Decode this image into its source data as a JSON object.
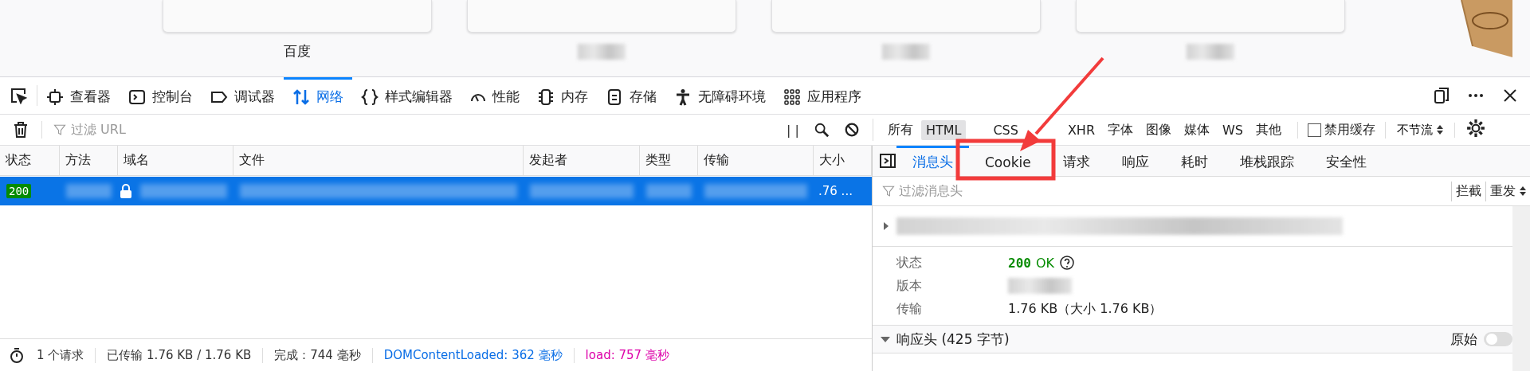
{
  "top_sites": [
    {
      "kind": "named",
      "label": "百度"
    },
    {
      "kind": "blurred"
    },
    {
      "kind": "blurred"
    },
    {
      "kind": "blurred"
    }
  ],
  "toolbar": {
    "tabs": [
      {
        "label": "查看器",
        "selected": false
      },
      {
        "label": "控制台",
        "selected": false
      },
      {
        "label": "调试器",
        "selected": false
      },
      {
        "label": "网络",
        "selected": true
      },
      {
        "label": "样式编辑器",
        "selected": false
      },
      {
        "label": "性能",
        "selected": false
      },
      {
        "label": "内存",
        "selected": false
      },
      {
        "label": "存储",
        "selected": false
      },
      {
        "label": "无障碍环境",
        "selected": false
      },
      {
        "label": "应用程序",
        "selected": false
      }
    ]
  },
  "filter_bar": {
    "placeholder": "过滤 URL",
    "pause": "| |",
    "types": [
      {
        "label": "所有",
        "selected": false
      },
      {
        "label": "HTML",
        "selected": true
      },
      {
        "label": "CSS",
        "selected": false
      },
      {
        "label": "XHR",
        "selected": false
      },
      {
        "label": "字体",
        "selected": false
      },
      {
        "label": "图像",
        "selected": false
      },
      {
        "label": "媒体",
        "selected": false
      },
      {
        "label": "WS",
        "selected": false
      },
      {
        "label": "其他",
        "selected": false
      }
    ],
    "disable_cache": {
      "label": "禁用缓存",
      "checked": false
    },
    "throttle": "不节流"
  },
  "table": {
    "columns": [
      "状态",
      "方法",
      "域名",
      "文件",
      "发起者",
      "类型",
      "传输",
      "大小"
    ],
    "rows": [
      {
        "status": "200",
        "size": ".76 ...",
        "selected": true
      }
    ]
  },
  "details": {
    "tabs": [
      {
        "label": "消息头",
        "selected": true
      },
      {
        "label": "Cookie",
        "selected": false
      },
      {
        "label": "请求",
        "selected": false
      },
      {
        "label": "响应",
        "selected": false
      },
      {
        "label": "耗时",
        "selected": false
      },
      {
        "label": "堆栈跟踪",
        "selected": false
      },
      {
        "label": "安全性",
        "selected": false
      }
    ],
    "filter_placeholder": "过滤消息头",
    "block": "拦截",
    "resend": "重发",
    "summary": [
      {
        "kind": "status",
        "label": "状态",
        "code": "200",
        "text": "OK"
      },
      {
        "kind": "blurred",
        "label": "版本"
      },
      {
        "kind": "text",
        "label": "传输",
        "value": "1.76 KB（大小 1.76 KB）"
      }
    ],
    "response_headers": {
      "title": "响应头 (425 字节)",
      "expanded": true,
      "raw_label": "原始",
      "raw_on": false
    }
  },
  "status_bar": [
    {
      "text": "1 个请求",
      "color": "#333333"
    },
    {
      "text": "已传输 1.76 KB / 1.76 KB",
      "color": "#333333"
    },
    {
      "text": "完成：744 毫秒",
      "color": "#333333"
    },
    {
      "text": "DOMContentLoaded: 362 毫秒",
      "color": "#0a6ee6"
    },
    {
      "text": "load: 757 毫秒",
      "color": "#dd00a9"
    }
  ]
}
